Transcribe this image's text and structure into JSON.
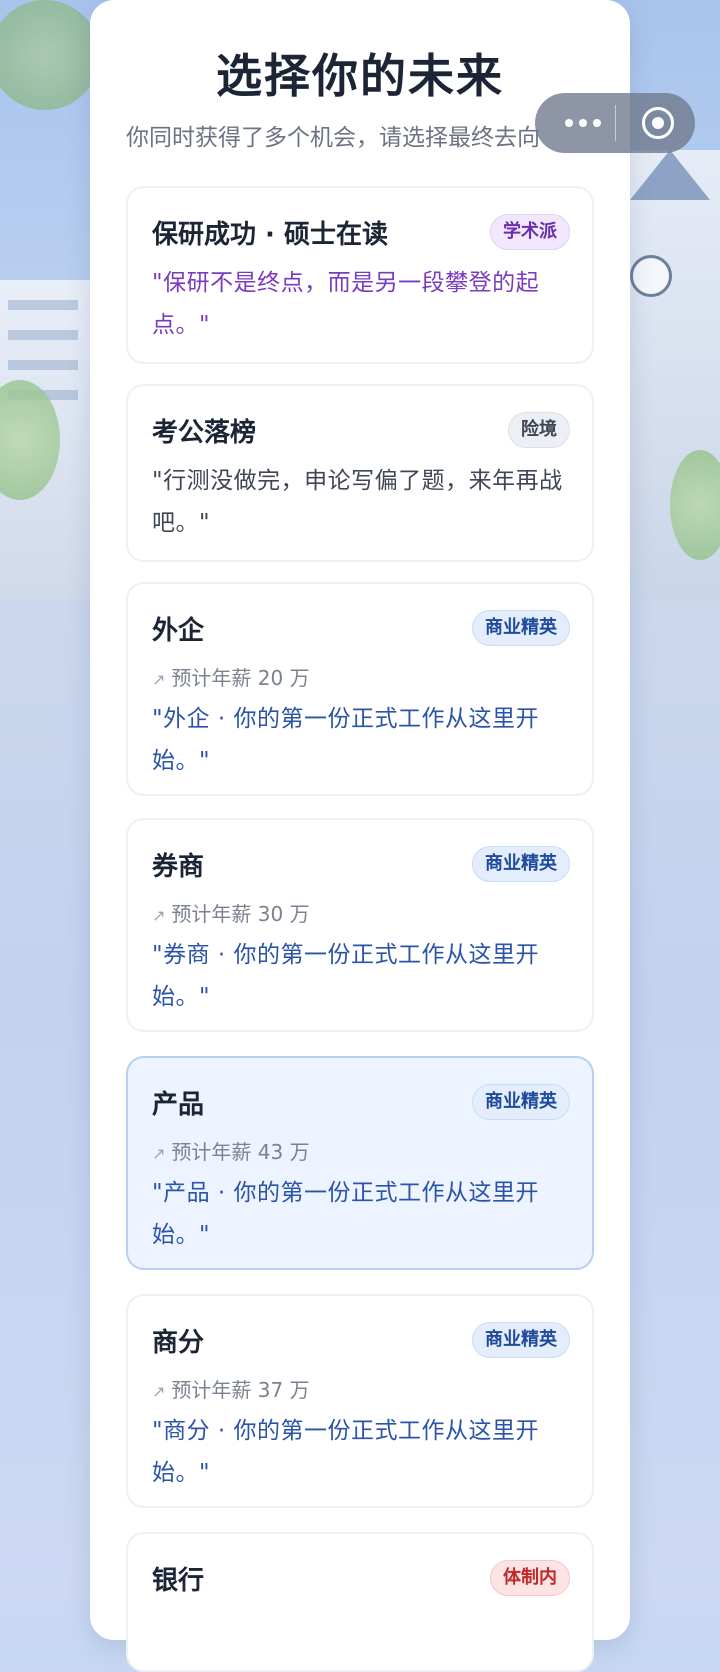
{
  "header": {
    "title": "选择你的未来",
    "subtitle": "你同时获得了多个机会，请选择最终去向"
  },
  "options": [
    {
      "name": "保研成功 · 硕士在读",
      "tag": "学术派",
      "salary": "",
      "quote": "\"保研不是终点，而是另一段攀登的起点。\""
    },
    {
      "name": "考公落榜",
      "tag": "险境",
      "salary": "",
      "quote": "\"行测没做完，申论写偏了题，来年再战吧。\""
    },
    {
      "name": "外企",
      "tag": "商业精英",
      "salary": "预计年薪 20 万",
      "quote": "\"外企 · 你的第一份正式工作从这里开始。\""
    },
    {
      "name": "券商",
      "tag": "商业精英",
      "salary": "预计年薪 30 万",
      "quote": "\"券商 · 你的第一份正式工作从这里开始。\""
    },
    {
      "name": "产品",
      "tag": "商业精英",
      "salary": "预计年薪 43 万",
      "quote": "\"产品 · 你的第一份正式工作从这里开始。\"",
      "selected": true
    },
    {
      "name": "商分",
      "tag": "商业精英",
      "salary": "预计年薪 37 万",
      "quote": "\"商分 · 你的第一份正式工作从这里开始。\""
    },
    {
      "name": "银行",
      "tag": "体制内",
      "salary": "",
      "quote": ""
    }
  ],
  "colors": {
    "academic": "#6a2fb0",
    "business": "#1f4a9a",
    "system": "#c0282a",
    "selected_bg": "#edf4ff"
  }
}
